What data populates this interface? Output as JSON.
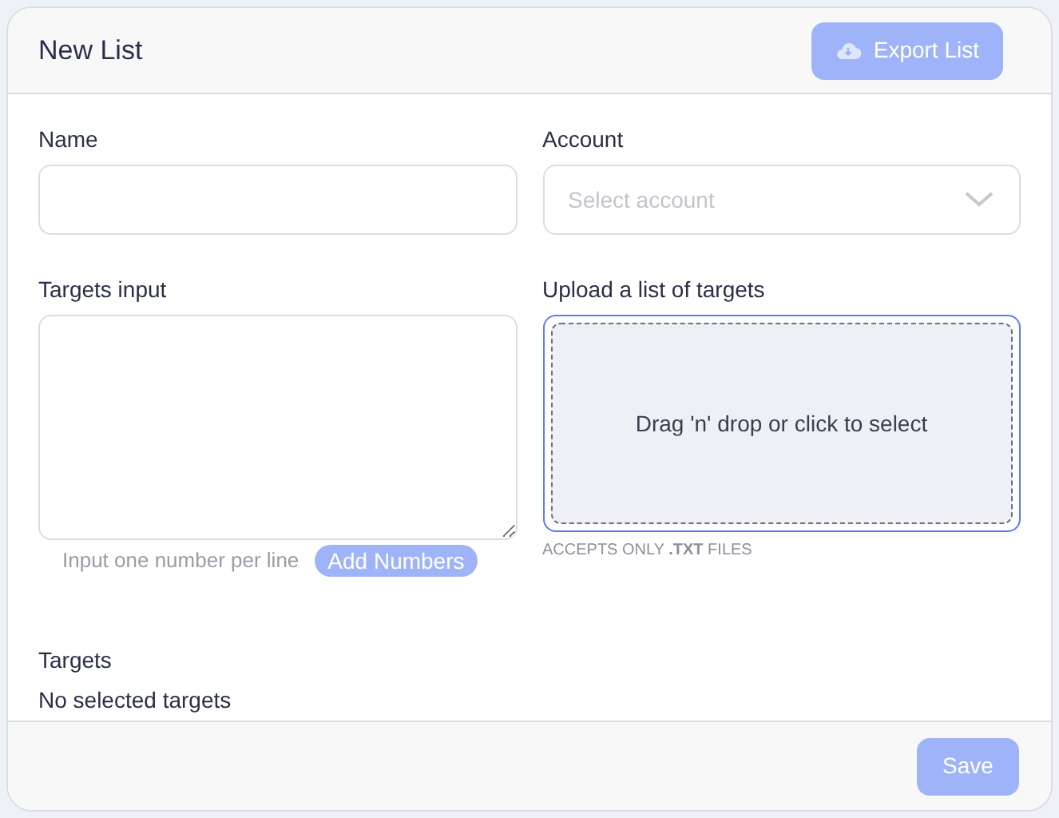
{
  "header": {
    "title": "New List",
    "export_button": {
      "label": "Export List",
      "disabled": true
    }
  },
  "name_field": {
    "label": "Name"
  },
  "account_field": {
    "label": "Account",
    "placeholder": "Select account"
  },
  "targets_input": {
    "label": "Targets input",
    "hint": "Input one number per line",
    "add_button": {
      "label": "Add Numbers",
      "disabled": true
    }
  },
  "upload": {
    "label": "Upload a list of targets",
    "prompt": "Drag 'n' drop or click to select",
    "focused": true,
    "note": "ACCEPTS ONLY **.TXT** FILES"
  },
  "targets": {
    "label": "Targets",
    "empty_text": "No selected targets"
  },
  "footer": {
    "save_button": {
      "label": "Save",
      "disabled": true
    }
  }
}
